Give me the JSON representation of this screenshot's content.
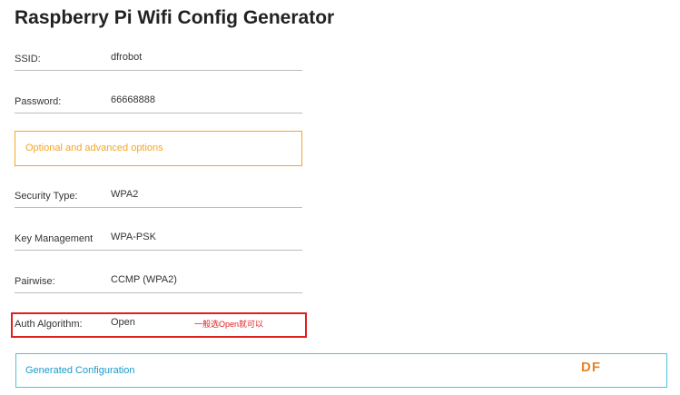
{
  "page": {
    "title": "Raspberry Pi Wifi Config Generator"
  },
  "fields": {
    "ssid": {
      "label": "SSID:",
      "value": "dfrobot"
    },
    "password": {
      "label": "Password:",
      "value": "66668888"
    },
    "security_type": {
      "label": "Security Type:",
      "value": "WPA2"
    },
    "key_management": {
      "label": "Key Management",
      "value": "WPA-PSK"
    },
    "pairwise": {
      "label": "Pairwise:",
      "value": "CCMP (WPA2)"
    },
    "auth_algorithm": {
      "label": "Auth Algorithm:",
      "value": "Open"
    }
  },
  "options_toggle": {
    "label": "Optional and advanced options"
  },
  "annotation": {
    "text": "一般选Open就可以"
  },
  "generated": {
    "label": "Generated Configuration"
  },
  "watermark": {
    "text": "DF"
  },
  "colors": {
    "accent_orange": "#f5a623",
    "highlight_red": "#e02020",
    "generated_border": "#4fc3d9",
    "generated_text": "#1a9bc9"
  }
}
